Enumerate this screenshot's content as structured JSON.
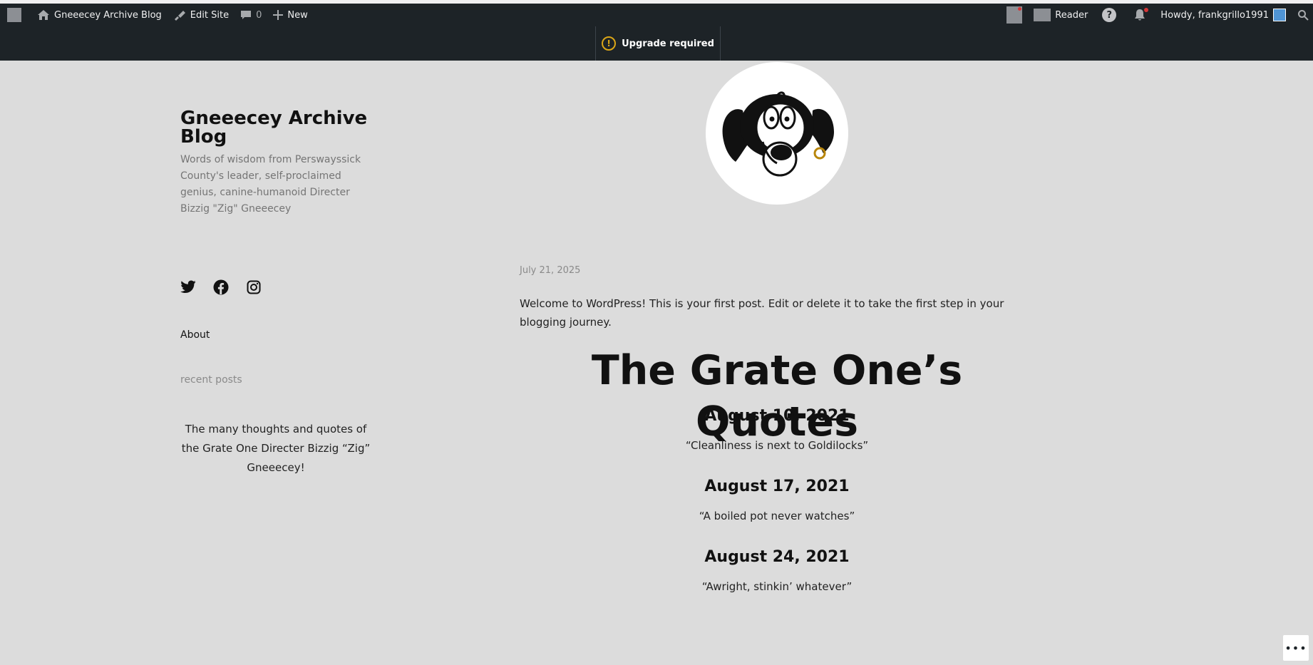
{
  "adminbar": {
    "site_name": "Gneeecey Archive Blog",
    "edit_site": "Edit Site",
    "comments_count": "0",
    "new_label": "New",
    "reader_label": "Reader",
    "greeting": "Howdy, frankgrillo1991"
  },
  "upgrade": {
    "label": "Upgrade required",
    "icon": "!"
  },
  "sidebar": {
    "site_title": "Gneeecey Archive Blog",
    "tagline": "Words of wisdom from Perswayssick County's leader, self-proclaimed genius, canine-humanoid Directer Bizzig \"Zig\" Gneeecey",
    "about_label": "About",
    "recent_posts_label": "recent posts",
    "description": "The many thoughts and quotes of the Grate One Directer Bizzig “Zig” Gneeecey!"
  },
  "post": {
    "date": "July 21, 2025",
    "intro": "Welcome to WordPress! This is your first post. Edit or delete it to take the first step in your blogging journey.",
    "heading": "The Grate One’s Quotes",
    "entries": [
      {
        "date": "August 10, 2021",
        "quote": "“Cleanliness is next to Goldilocks”"
      },
      {
        "date": "August 17, 2021",
        "quote": "“A boiled pot never watches”"
      },
      {
        "date": "August 24, 2021",
        "quote": "“Awright, stinkin’ whatever”"
      }
    ]
  },
  "more_button": "•••",
  "colors": {
    "admin_bg": "#1d2327",
    "page_bg": "#dcdcdc",
    "warning": "#dba617",
    "notification": "#d63638"
  }
}
